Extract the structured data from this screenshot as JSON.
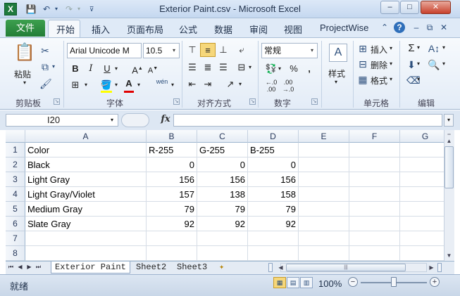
{
  "window": {
    "title": "Exterior Paint.csv - Microsoft Excel",
    "app_icon": "X",
    "quick_access": [
      "save-icon",
      "undo-icon",
      "redo-icon",
      "customize-icon"
    ],
    "buttons": {
      "minimize": "–",
      "maximize": "□",
      "close": "✕"
    }
  },
  "ribbon_tabs": {
    "file": "文件",
    "tabs": [
      "开始",
      "插入",
      "页面布局",
      "公式",
      "数据",
      "审阅",
      "视图",
      "ProjectWise"
    ],
    "active": "开始"
  },
  "ribbon": {
    "clipboard": {
      "label": "剪贴板",
      "paste": "粘贴"
    },
    "font": {
      "label": "字体",
      "font_name": "Arial Unicode M",
      "font_size": "10.5",
      "phonetic": "wén"
    },
    "alignment": {
      "label": "对齐方式"
    },
    "number": {
      "label": "数字",
      "format": "常规"
    },
    "styles": {
      "label": "样式"
    },
    "cells": {
      "label": "单元格",
      "insert": "插入",
      "delete": "删除",
      "format": "格式"
    },
    "editing": {
      "label": "编辑",
      "sum": "Σ"
    }
  },
  "formula_bar": {
    "name_box": "I20",
    "fx": "fx",
    "value": ""
  },
  "grid": {
    "columns": [
      "A",
      "B",
      "C",
      "D",
      "E",
      "F",
      "G"
    ],
    "rows": [
      "1",
      "2",
      "3",
      "4",
      "5",
      "6",
      "7",
      "8"
    ],
    "cells": [
      [
        "Color",
        "R-255",
        "G-255",
        "B-255",
        "",
        "",
        ""
      ],
      [
        "Black",
        "0",
        "0",
        "0",
        "",
        "",
        ""
      ],
      [
        "Light Gray",
        "156",
        "156",
        "156",
        "",
        "",
        ""
      ],
      [
        "Light Gray/Violet",
        "157",
        "138",
        "158",
        "",
        "",
        ""
      ],
      [
        "Medium Gray",
        "79",
        "79",
        "79",
        "",
        "",
        ""
      ],
      [
        "Slate Gray",
        "92",
        "92",
        "92",
        "",
        "",
        ""
      ],
      [
        "",
        "",
        "",
        "",
        "",
        "",
        ""
      ],
      [
        "",
        "",
        "",
        "",
        "",
        "",
        ""
      ]
    ]
  },
  "sheets": {
    "tabs": [
      "Exterior Paint",
      "Sheet2",
      "Sheet3"
    ],
    "active": "Exterior Paint"
  },
  "status_bar": {
    "status": "就绪",
    "zoom": "100%"
  }
}
